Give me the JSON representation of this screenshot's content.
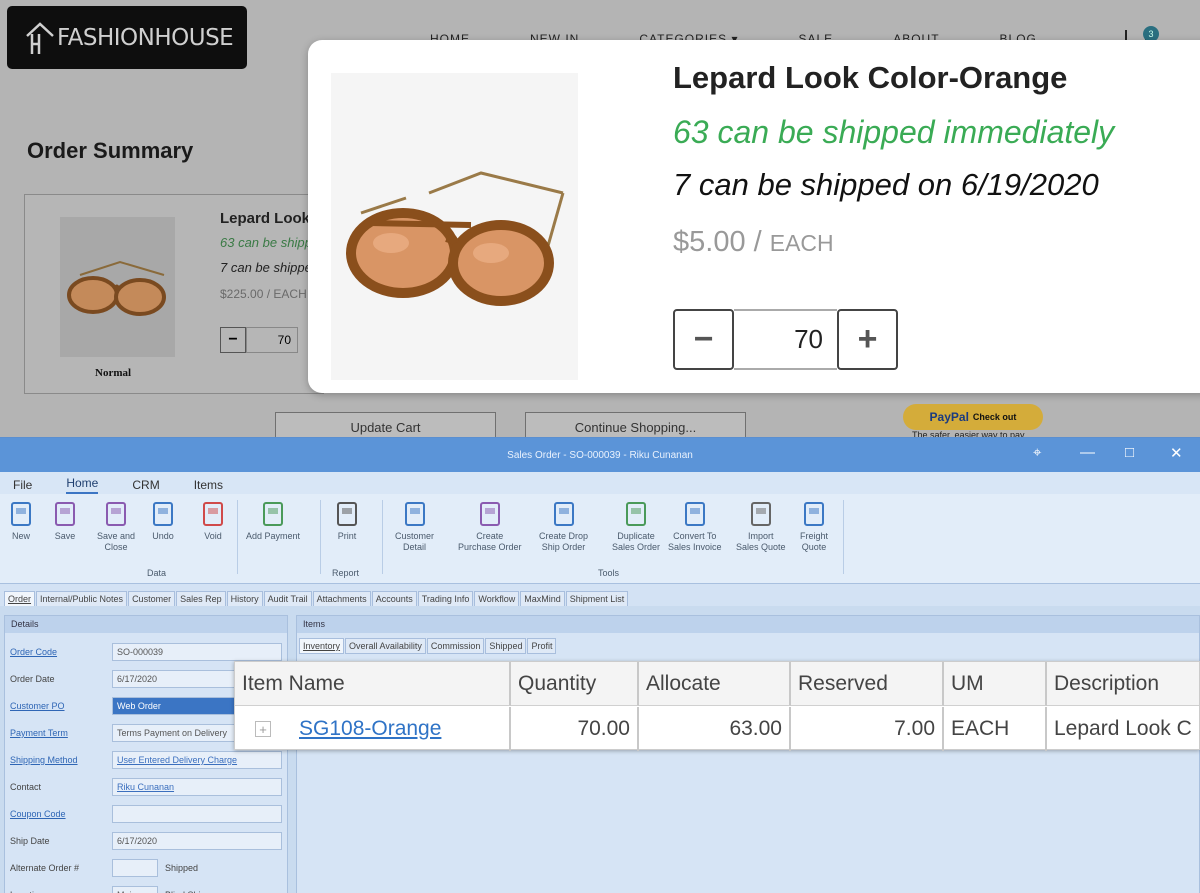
{
  "store": {
    "logo_text": "FASHIONHOUSE",
    "nav": [
      "HOME",
      "NEW IN",
      "CATEGORIES ▾",
      "SALE",
      "ABOUT",
      "BLOG"
    ],
    "cart_count": "3",
    "order_summary_title": "Order Summary",
    "card": {
      "name": "Lepard Look Color-Orange",
      "ship_now": "63 can be shipped immediately",
      "ship_later": "7 can be shipped on 6/19/2020",
      "price": "$225.00",
      "unit": "EACH",
      "qty": "70",
      "image_caption": "Normal"
    },
    "update_cart": "Update Cart",
    "continue_shopping": "Continue Shopping...",
    "paypal_label": "PayPal",
    "paypal_checkout": "Check out",
    "paypal_note": "The safer, easier way to pay"
  },
  "popup": {
    "name": "Lepard Look Color-Orange",
    "ship_now": "63 can be shipped immediately",
    "ship_later": "7 can be shipped on 6/19/2020",
    "price": "$5.00",
    "price_sep": " / ",
    "unit": "EACH",
    "qty": "70",
    "minus": "−",
    "plus": "+"
  },
  "erp": {
    "title": "Sales Order - SO-000039 - Riku Cunanan",
    "menu": [
      "File",
      "Home",
      "CRM",
      "Items"
    ],
    "ribbon_buttons": [
      {
        "label": "New",
        "icon": "new-document-icon"
      },
      {
        "label": "Save",
        "icon": "save-icon"
      },
      {
        "label": "Save and\nClose",
        "icon": "save-close-icon"
      },
      {
        "label": "Undo",
        "icon": "undo-icon"
      },
      {
        "label": "Void",
        "icon": "void-icon"
      },
      {
        "label": "Add Payment",
        "icon": "add-payment-icon"
      },
      {
        "label": "Print",
        "icon": "printer-icon"
      },
      {
        "label": "Customer\nDetail",
        "icon": "customer-icon"
      },
      {
        "label": "Create\nPurchase Order",
        "icon": "purchase-order-icon"
      },
      {
        "label": "Create Drop\nShip Order",
        "icon": "drop-ship-icon"
      },
      {
        "label": "Duplicate\nSales Order",
        "icon": "duplicate-icon"
      },
      {
        "label": "Convert To\nSales Invoice",
        "icon": "invoice-icon"
      },
      {
        "label": "Import\nSales Quote",
        "icon": "import-quote-icon"
      },
      {
        "label": "Freight\nQuote",
        "icon": "freight-icon"
      }
    ],
    "ribbon_groups": [
      "Data",
      "Report",
      "Tools"
    ],
    "tabs": [
      "Order",
      "Internal/Public Notes",
      "Customer",
      "Sales Rep",
      "History",
      "Audit Trail",
      "Attachments",
      "Accounts",
      "Trading Info",
      "Workflow",
      "MaxMind",
      "Shipment List"
    ],
    "details_title": "Details",
    "items_title": "Items",
    "item_tabs": [
      "Inventory",
      "Overall Availability",
      "Commission",
      "Shipped",
      "Profit"
    ],
    "fields": [
      {
        "label": "Order Code",
        "value": "SO-000039",
        "link": true
      },
      {
        "label": "Order Date",
        "value": "6/17/2020",
        "link": false
      },
      {
        "label": "Customer PO",
        "value": "Web Order",
        "link": true
      },
      {
        "label": "Payment Term",
        "value": "Terms Payment on Delivery",
        "link": true
      },
      {
        "label": "Shipping Method",
        "value": "User Entered Delivery Charge",
        "link": true
      },
      {
        "label": "Contact",
        "value": "Riku Cunanan",
        "link": false
      },
      {
        "label": "Coupon Code",
        "value": "",
        "link": true
      },
      {
        "label": "Ship Date",
        "value": "6/17/2020",
        "link": false
      },
      {
        "label": "Alternate Order #",
        "value": "",
        "link": false
      },
      {
        "label": "Location",
        "value": "Main",
        "link": false
      }
    ],
    "shipped_label": "Shipped",
    "blind_ship_label": "Blind Ship"
  },
  "grid": {
    "headers": [
      "Item Name",
      "Quantity",
      "Allocate",
      "Reserved",
      "UM",
      "Description"
    ],
    "rows": [
      {
        "item": "SG108-Orange",
        "quantity": "70.00",
        "allocate": "63.00",
        "reserved": "7.00",
        "um": "EACH",
        "description": "Lepard Look C"
      }
    ],
    "expand_symbol": "+"
  }
}
